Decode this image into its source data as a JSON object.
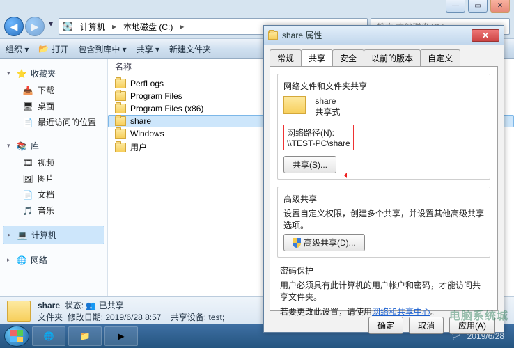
{
  "window": {
    "min": "—",
    "max": "▭",
    "close": "✕"
  },
  "nav": {
    "back": "◀",
    "forward": "▶",
    "dropdown": "▾",
    "crumbs": [
      "计算机",
      "本地磁盘 (C:)"
    ],
    "search_placeholder": "搜索 本地磁盘 (C:)"
  },
  "toolbar": {
    "organize": "组织 ▾",
    "open": "打开",
    "include": "包含到库中 ▾",
    "share": "共享 ▾",
    "newfolder": "新建文件夹"
  },
  "sidebar": {
    "fav": {
      "label": "收藏夹",
      "items": [
        "下载",
        "桌面",
        "最近访问的位置"
      ]
    },
    "lib": {
      "label": "库",
      "items": [
        "视频",
        "图片",
        "文档",
        "音乐"
      ]
    },
    "computer": "计算机",
    "network": "网络"
  },
  "list": {
    "header": "名称",
    "rows": [
      "PerfLogs",
      "Program Files",
      "Program Files (x86)",
      "share",
      "Windows",
      "用户"
    ]
  },
  "details": {
    "name": "share",
    "state_label": "状态:",
    "state_value": "已共享",
    "type_label": "文件夹",
    "mod_label": "修改日期:",
    "mod_value": "2019/6/28 8:57",
    "share_dev_label": "共享设备:",
    "share_dev_value": "test;"
  },
  "dialog": {
    "title": "share 属性",
    "tabs": [
      "常规",
      "共享",
      "安全",
      "以前的版本",
      "自定义"
    ],
    "active_tab": 1,
    "sec1_title": "网络文件和文件夹共享",
    "share_name": "share",
    "share_state": "共享式",
    "netpath_label": "网络路径(N):",
    "netpath_value": "\\\\TEST-PC\\share",
    "btn_share": "共享(S)...",
    "sec2_title": "高级共享",
    "sec2_desc": "设置自定义权限，创建多个共享，并设置其他高级共享选项。",
    "btn_adv": "高级共享(D)...",
    "sec3_title": "密码保护",
    "sec3_desc": "用户必须具有此计算机的用户帐户和密码，才能访问共享文件夹。",
    "sec3_link_pre": "若要更改此设置，请使用",
    "sec3_link": "网络和共享中心",
    "ok": "确定",
    "cancel": "取消",
    "apply": "应用(A)"
  },
  "taskbar": {
    "clock": "2019/6/28"
  },
  "watermark": "电脑系统城"
}
